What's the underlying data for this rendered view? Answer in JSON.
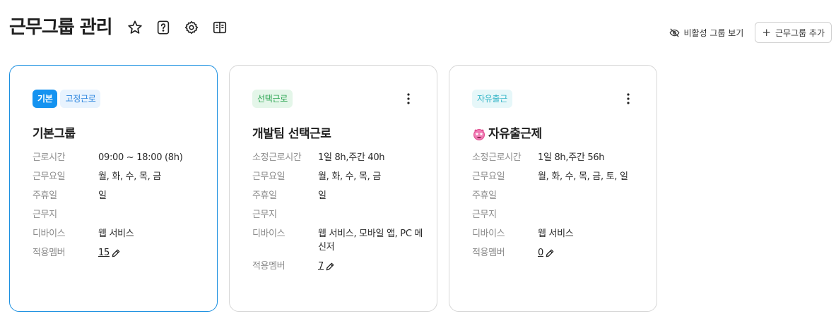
{
  "header": {
    "title": "근무그룹 관리",
    "icons": [
      "star-icon",
      "help-icon",
      "gear-icon",
      "book-icon"
    ]
  },
  "actions": {
    "inactive_label": "비활성 그룹 보기",
    "add_label": "근무그룹 추가"
  },
  "colors": {
    "accent": "#1593f0",
    "active_border": "#1a8fe0"
  },
  "cards": [
    {
      "badges": [
        "기본",
        "고정근로"
      ],
      "name": "기본그룹",
      "rows": [
        {
          "label": "근로시간",
          "value": "09:00 ~ 18:00 (8h)"
        },
        {
          "label": "근무요일",
          "value": "월, 화, 수, 목, 금"
        },
        {
          "label": "주휴일",
          "value": "일"
        },
        {
          "label": "근무지",
          "value": ""
        },
        {
          "label": "디바이스",
          "value": "웹 서비스"
        },
        {
          "label": "적용멤버",
          "value": "15"
        }
      ]
    },
    {
      "badges": [
        "선택근로"
      ],
      "name": "개발팀 선택근로",
      "rows": [
        {
          "label": "소정근로시간",
          "value": "1일 8h,주간 40h"
        },
        {
          "label": "근무요일",
          "value": "월, 화, 수, 목, 금"
        },
        {
          "label": "주휴일",
          "value": "일"
        },
        {
          "label": "근무지",
          "value": ""
        },
        {
          "label": "디바이스",
          "value": "웹 서비스, 모바일 앱, PC 메신저"
        },
        {
          "label": "적용멤버",
          "value": "7"
        }
      ]
    },
    {
      "badges": [
        "자유출근"
      ],
      "name": "자유출근제",
      "name_icon": "star-eyes-face-icon",
      "rows": [
        {
          "label": "소정근로시간",
          "value": "1일 8h,주간 56h"
        },
        {
          "label": "근무요일",
          "value": "월, 화, 수, 목, 금, 토, 일"
        },
        {
          "label": "주휴일",
          "value": ""
        },
        {
          "label": "근무지",
          "value": ""
        },
        {
          "label": "디바이스",
          "value": "웹 서비스"
        },
        {
          "label": "적용멤버",
          "value": "0"
        }
      ]
    }
  ]
}
